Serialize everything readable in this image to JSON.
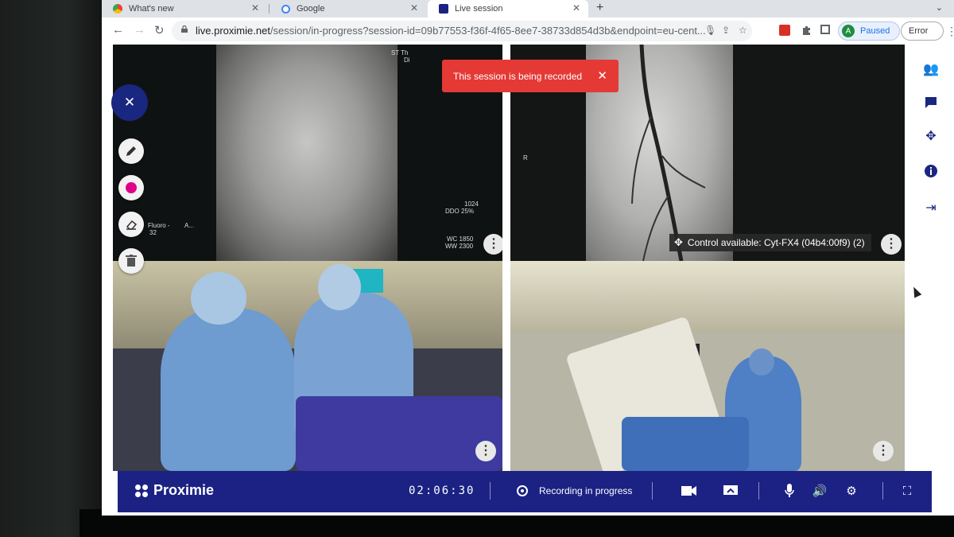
{
  "browser": {
    "tabs": [
      {
        "label": "What's new",
        "icon": "chrome-icon"
      },
      {
        "label": "Google",
        "icon": "google-icon"
      },
      {
        "label": "Live session",
        "icon": "proximie-icon"
      }
    ],
    "url_host": "live.proximie.net",
    "url_rest": "/session/in-progress?session-id=09b77553-f36f-4f65-8ee7-38733d854d3b&endpoint=eu-cent...",
    "profile_initial": "A",
    "profile_status": "Paused",
    "error_label": "Error"
  },
  "toast": {
    "message": "This session is being recorded",
    "color": "#e53935"
  },
  "panes": {
    "top_left": {
      "overlay_top": "ST Th",
      "overlay_top2": "Di",
      "overlay_mid1": "1024",
      "overlay_mid2": "DDO 25%",
      "overlay_left1": "Fluoro -",
      "overlay_left2": "A...",
      "overlay_left3": "32",
      "overlay_wc": "WC 1850",
      "overlay_ww": "WW 2300"
    },
    "top_right": {
      "overlay_r": "R",
      "control_label": "Control available: Cyt-FX4 (04b4:00f9) (2)"
    }
  },
  "bottom_bar": {
    "brand": "Proximie",
    "timer": "02:06:30",
    "recording_label": "Recording in progress",
    "color": "#1b2283"
  },
  "accent_color": "#1a2780"
}
